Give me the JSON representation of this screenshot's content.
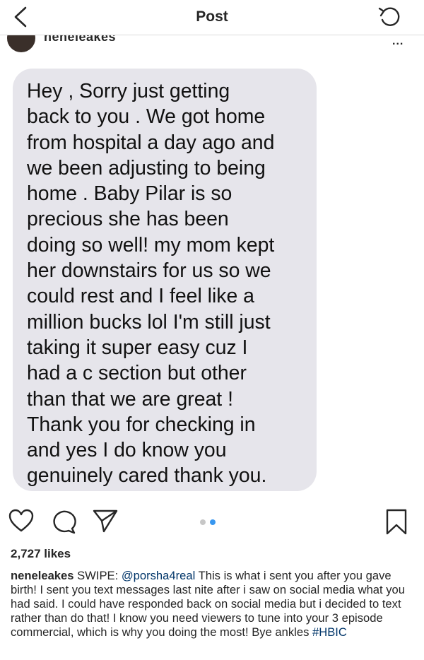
{
  "nav": {
    "title": "Post",
    "back_icon": "chevron-left-icon",
    "refresh_icon": "refresh-icon"
  },
  "header": {
    "username": "neneleakes",
    "more_label": "..."
  },
  "message": {
    "text": "Hey , Sorry  just getting\nback to you . We got home\nfrom hospital a day ago and\nwe been adjusting to being\nhome . Baby Pilar  is so\nprecious she has been\ndoing so well! my mom kept\nher downstairs for us so we\ncould rest and I feel like a\nmillion bucks lol I'm still just\ntaking it super easy cuz I\nhad a c section but other\nthan that we are great !\nThank you for checking in\nand yes I do know you\ngenuinely cared thank you."
  },
  "actions": {
    "like_icon": "heart-icon",
    "comment_icon": "comment-icon",
    "share_icon": "paper-plane-icon",
    "save_icon": "bookmark-icon",
    "carousel_count": 2,
    "carousel_active": 2
  },
  "likes": "2,727 likes",
  "caption": {
    "username": "neneleakes",
    "pre": "SWIPE: ",
    "mention": "@porsha4real",
    "body": " This is what i sent you after you gave birth! I sent you text messages last nite after i saw on social media what you had said. I could have responded back on social media but i decided to text rather than do that! I know you need viewers to tune into your 3 episode commercial, which is why you doing the most! Bye ankles ",
    "hashtag": "#HBIC"
  },
  "colors": {
    "bubble": "#e6e5eb",
    "link": "#003569",
    "carousel_active": "#3897f0"
  }
}
